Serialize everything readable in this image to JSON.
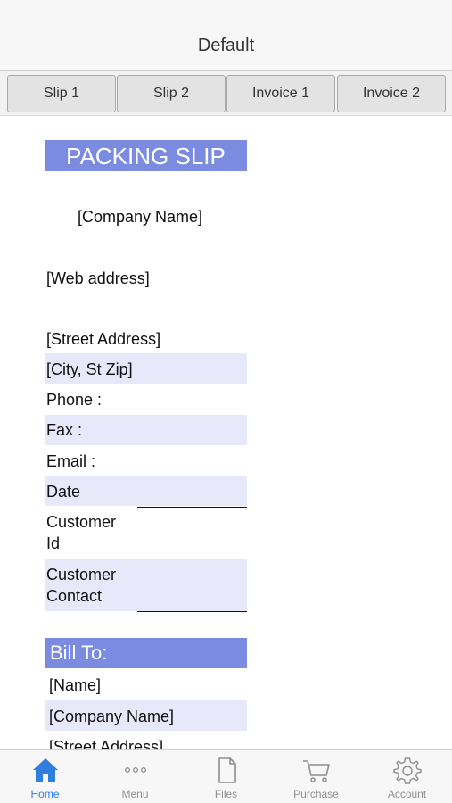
{
  "header": {
    "title": "Default"
  },
  "tabs": [
    {
      "label": "Slip 1"
    },
    {
      "label": "Slip 2"
    },
    {
      "label": "Invoice 1"
    },
    {
      "label": "Invoice 2"
    }
  ],
  "document": {
    "heading": "PACKING SLIP",
    "company_name": "[Company Name]",
    "web_address": "[Web address]",
    "street_address": "[Street Address]",
    "city_state_zip": "[City, St  Zip]",
    "phone_label": "Phone :",
    "fax_label": "Fax :",
    "email_label": "Email :",
    "date_label": "Date",
    "customer_id_label_1": "Customer",
    "customer_id_label_2": "Id",
    "customer_contact_label_1": "Customer",
    "customer_contact_label_2": "Contact",
    "bill_to": {
      "heading": "Bill To:",
      "name": "[Name]",
      "company_name": "[Company Name]",
      "street_address": "[Street Address]"
    },
    "colors": {
      "heading_band": "#7b8ce0",
      "row_band": "#e8e8fb"
    }
  },
  "tabbar": {
    "items": [
      {
        "label": "Home",
        "icon": "home-icon",
        "active": true
      },
      {
        "label": "Menu",
        "icon": "more-icon"
      },
      {
        "label": "Files",
        "icon": "file-icon"
      },
      {
        "label": "Purchase",
        "icon": "cart-icon"
      },
      {
        "label": "Account",
        "icon": "gear-icon"
      }
    ],
    "active_color": "#2f7ee0",
    "inactive_color": "#8e8e93"
  }
}
